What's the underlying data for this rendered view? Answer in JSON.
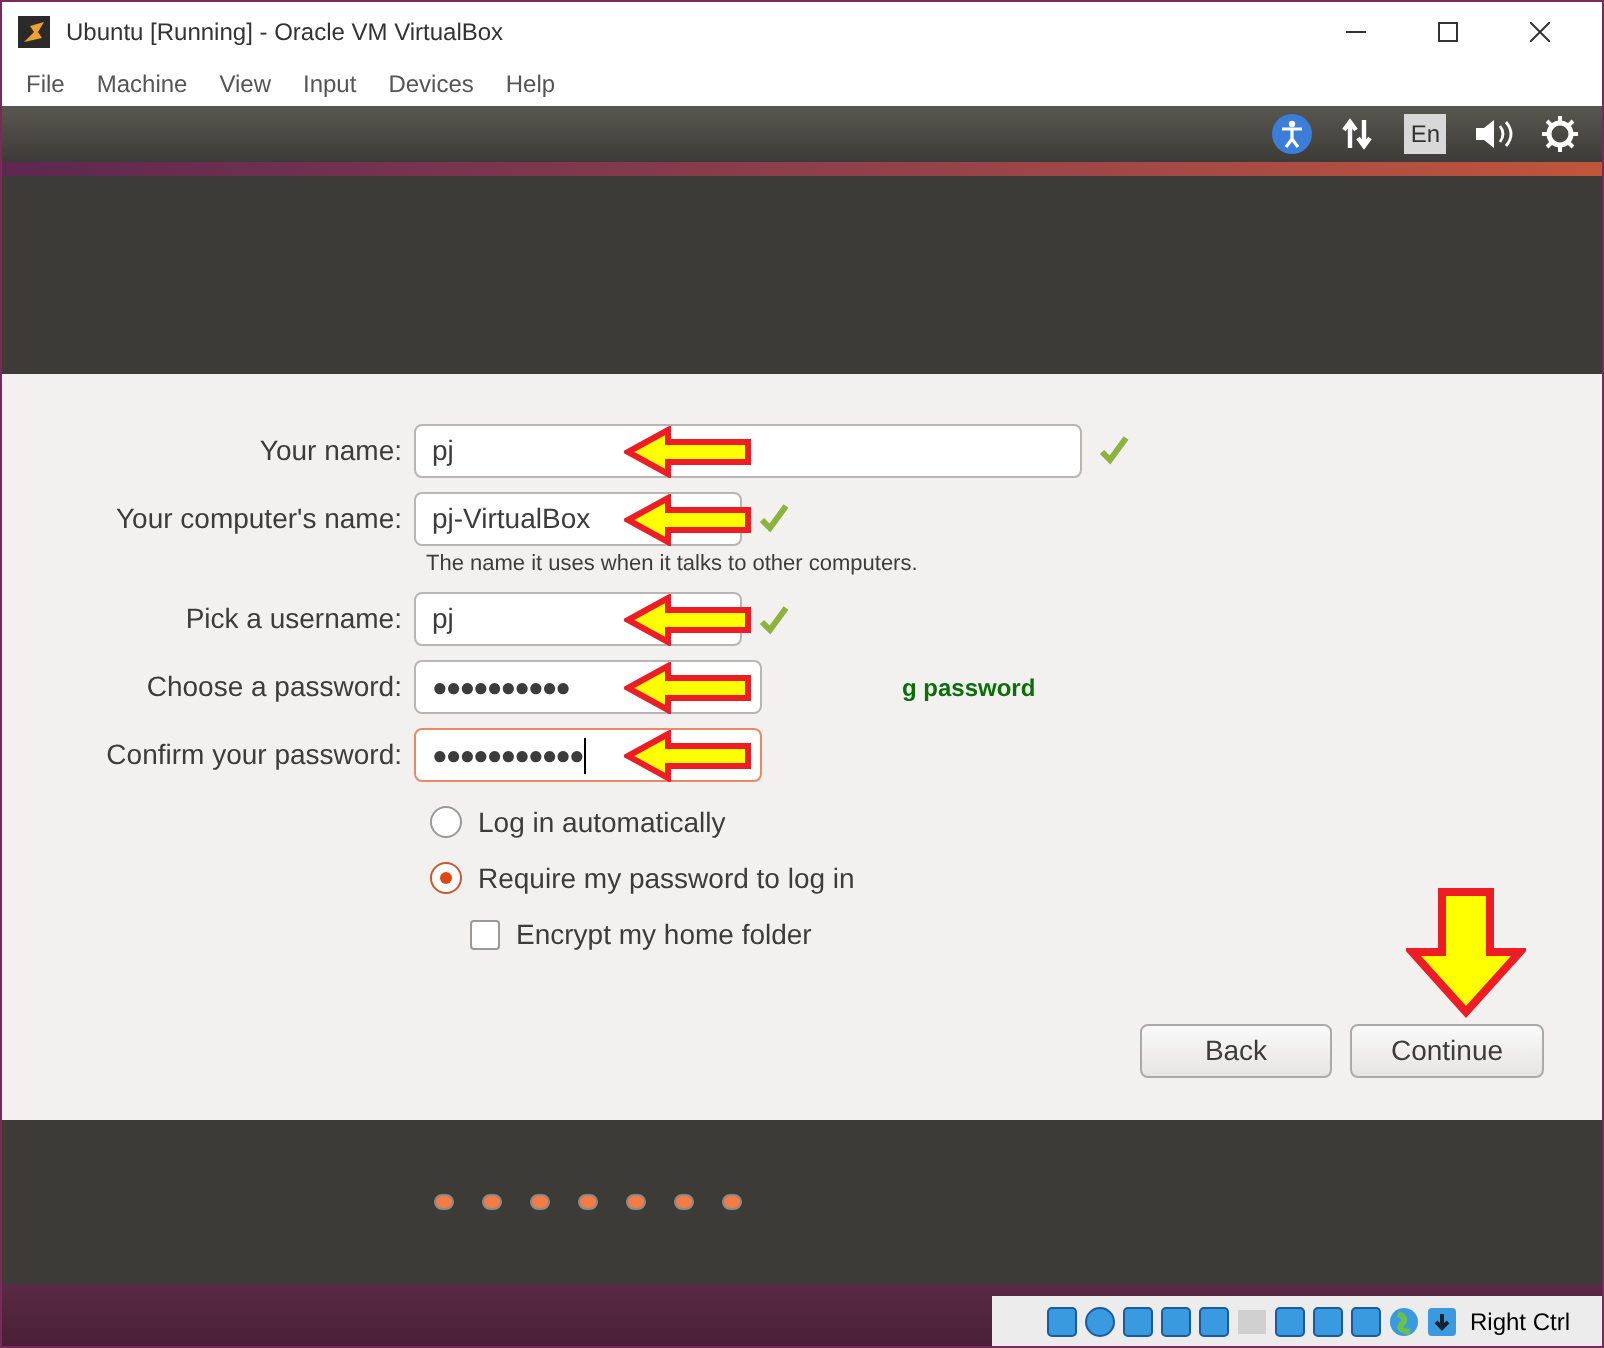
{
  "window": {
    "title": "Ubuntu [Running] - Oracle VM VirtualBox"
  },
  "menu": [
    "File",
    "Machine",
    "View",
    "Input",
    "Devices",
    "Help"
  ],
  "top_panel": {
    "keyboard": "En"
  },
  "form": {
    "fields": [
      {
        "label": "Your name:",
        "value": "pj",
        "valid": true,
        "focused": false
      },
      {
        "label": "Your computer's name:",
        "value": "pj-VirtualBox",
        "valid": true,
        "focused": false,
        "hint": "The name it uses when it talks to other computers."
      },
      {
        "label": "Pick a username:",
        "value": "pj",
        "valid": true,
        "focused": false
      },
      {
        "label": "Choose a password:",
        "value": "●●●●●●●●●●",
        "focused": false,
        "strength": "g password"
      },
      {
        "label": "Confirm your password:",
        "value": "●●●●●●●●●●●",
        "focused": true
      }
    ],
    "login_options": [
      {
        "label": "Log in automatically",
        "selected": false
      },
      {
        "label": "Require my password to log in",
        "selected": true
      }
    ],
    "encrypt": {
      "label": "Encrypt my home folder",
      "checked": false
    },
    "buttons": [
      "Back",
      "Continue"
    ]
  },
  "status_bar": {
    "host_key": "Right Ctrl"
  }
}
